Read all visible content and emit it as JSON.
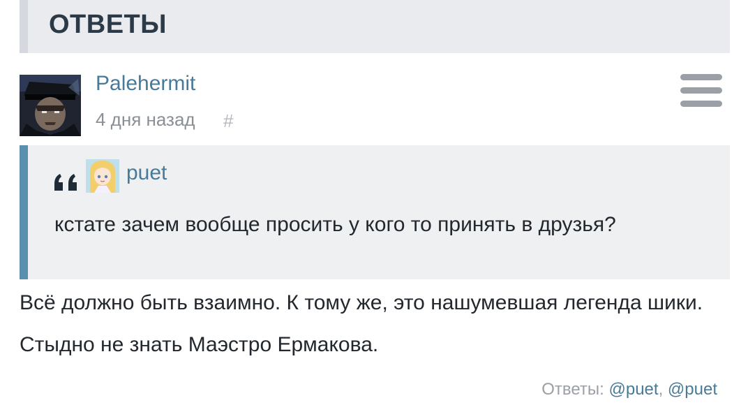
{
  "section": {
    "title": "ОТВЕТЫ"
  },
  "comment": {
    "author": "Palehermit",
    "time": "4 дня назад",
    "permalink": "#",
    "avatar_icon": "user-avatar",
    "menu_icon": "hamburger-menu-icon",
    "quote": {
      "mark": "“",
      "author": "puet",
      "avatar_icon": "user-avatar-small",
      "text": "кстате зачем вообще просить у кого то принять в друзья?"
    },
    "body": "Всё должно быть взаимно. К тому же, это нашумевшая легенда шики. Стыдно не знать Маэстро Ермакова.",
    "replies": {
      "label": "Ответы:",
      "mentions": [
        "@puet",
        "@puet"
      ],
      "separator": ","
    }
  },
  "colors": {
    "header_bg": "#e9ebee",
    "quote_bg": "#eef0f2",
    "quote_bar": "#5b8fae",
    "link": "#4a7a99",
    "muted": "#8a8f95"
  }
}
